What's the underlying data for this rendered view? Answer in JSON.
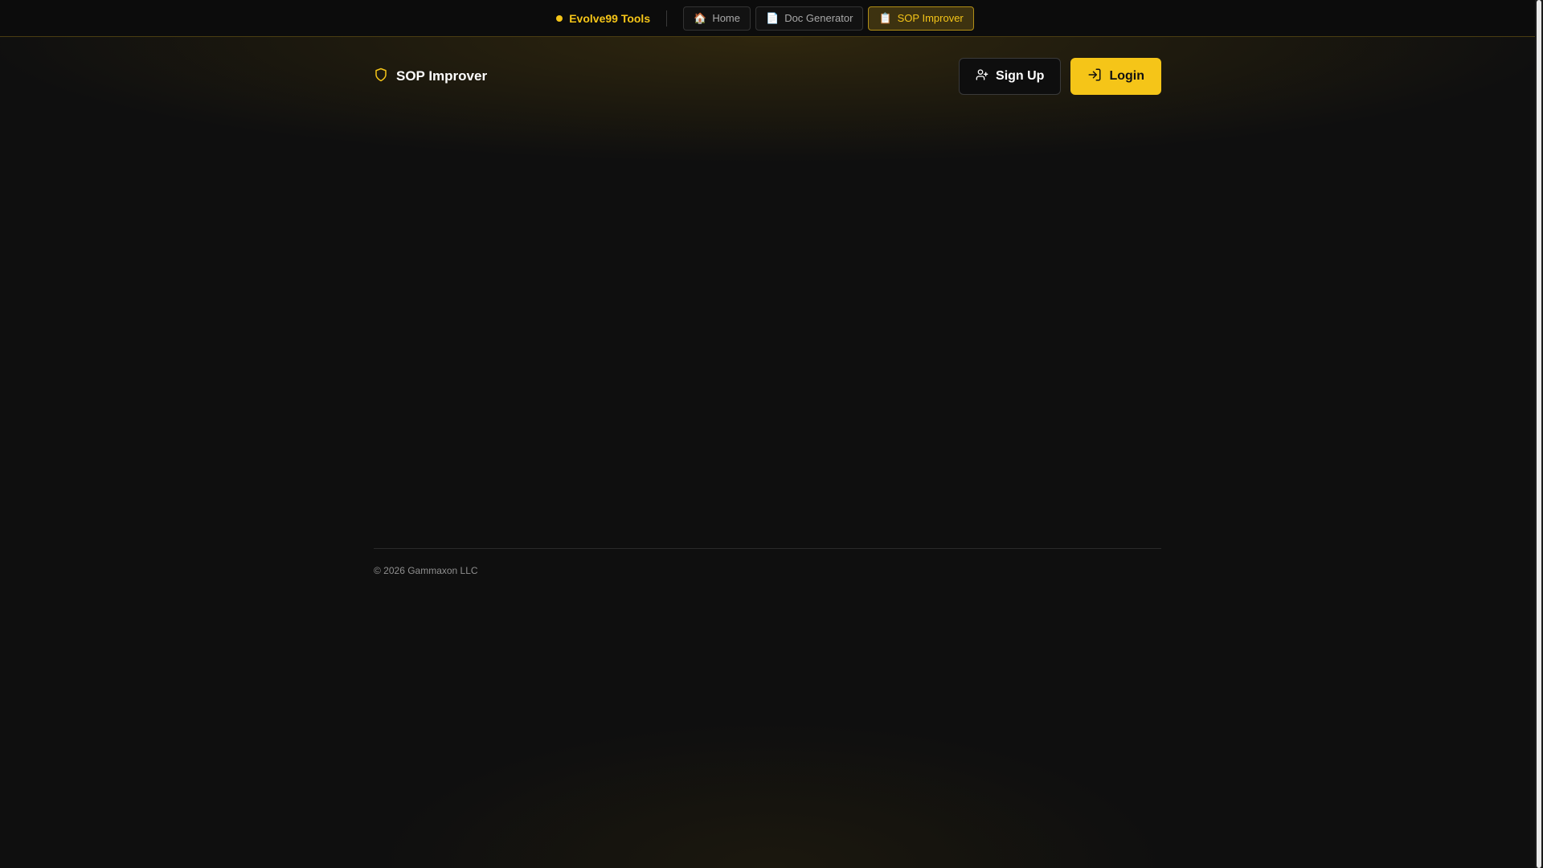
{
  "topbar": {
    "brand": "Evolve99 Tools",
    "tabs": [
      {
        "label": "Home",
        "icon": "🏠",
        "icon_name": "home-icon",
        "active": false
      },
      {
        "label": "Doc Generator",
        "icon": "📄",
        "icon_name": "document-icon",
        "active": false
      },
      {
        "label": "SOP Improver",
        "icon": "📋",
        "icon_name": "clipboard-icon",
        "active": true
      }
    ]
  },
  "header": {
    "title": "SOP Improver",
    "logo_icon": "shield-icon",
    "signup_label": "Sign Up",
    "signup_icon": "user-icon",
    "login_label": "Login",
    "login_icon": "login-icon"
  },
  "footer": {
    "copyright": "© 2026 Gammaxon LLC"
  },
  "colors": {
    "accent": "#f5c518",
    "background": "#0f0f0f",
    "active_tab_bg": "#3d3210"
  }
}
